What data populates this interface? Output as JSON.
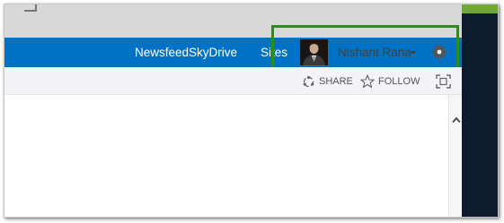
{
  "suitebar": {
    "links": [
      {
        "label": "Newsfeed"
      },
      {
        "label": "SkyDrive"
      },
      {
        "label": "Sites"
      }
    ],
    "user_name": "Nishant Rana"
  },
  "page_actions": {
    "share_label": "SHARE",
    "follow_label": "FOLLOW"
  },
  "icons": {
    "settings": "gear-icon",
    "share": "share-icon",
    "follow": "star-icon",
    "focus": "focus-on-content-icon",
    "scroll": "chevron-up-icon"
  },
  "colors": {
    "suitebar": "#0072c6",
    "highlight": "#2e8b1f",
    "accent_green": "#6fa834",
    "right_panel": "#0e1b2c"
  }
}
